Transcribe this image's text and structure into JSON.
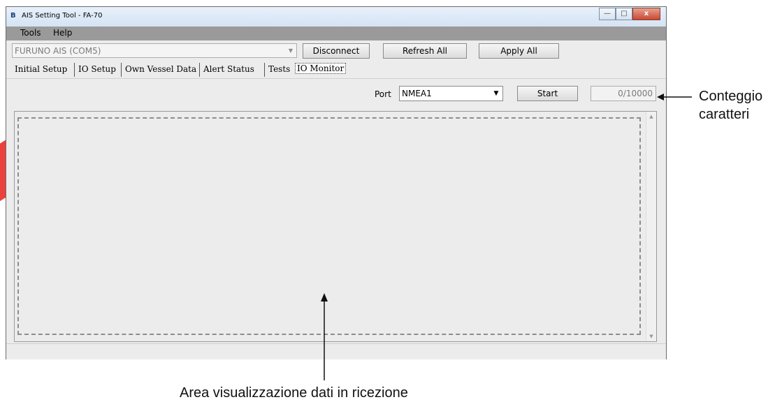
{
  "window": {
    "title": "AIS Setting Tool - FA-70",
    "app_icon": "B",
    "buttons": {
      "minimize": "—",
      "maximize": "□",
      "close": "x"
    }
  },
  "menu": {
    "items": [
      "Tools",
      "Help"
    ]
  },
  "toolbar": {
    "connection_value": "FURUNO AIS (COM5)",
    "disconnect_label": "Disconnect",
    "refresh_label": "Refresh All",
    "apply_label": "Apply All"
  },
  "tabs": [
    "Initial Setup",
    "IO Setup",
    "Own Vessel Data",
    "Alert Status",
    "Tests",
    "IO Monitor"
  ],
  "active_tab": "IO Monitor",
  "monitor": {
    "port_label": "Port",
    "port_value": "NMEA1",
    "start_label": "Start",
    "counter": "0/10000"
  },
  "annotations": {
    "counter_line1": "Conteggio",
    "counter_line2": "caratteri",
    "data_area": "Area visualizzazione dati in ricezione"
  },
  "colors": {
    "watermark": "#e8201b",
    "menubar": "#9a9a9a"
  }
}
